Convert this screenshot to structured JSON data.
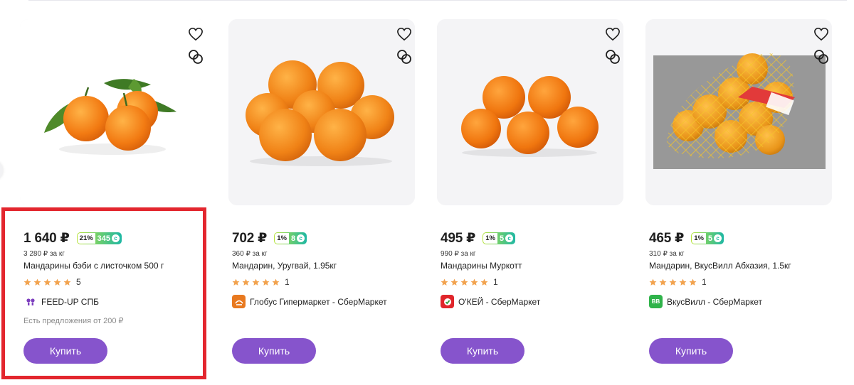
{
  "currency": "₽",
  "products": [
    {
      "price": "1 640 ₽",
      "bonus_percent": "21%",
      "bonus_points": "345",
      "unit_price": "3 280 ₽ за кг",
      "title": "Мандарины бэби с листочком 500 г",
      "rating_stars": 5,
      "rating_count": "5",
      "seller": "FEED-UP СПБ",
      "seller_logo_icon": "feedup-logo-icon",
      "seller_logo_color": "#ffffff",
      "offers": "Есть предложения от 200 ₽",
      "buy_label": "Купить",
      "highlighted": true
    },
    {
      "price": "702 ₽",
      "bonus_percent": "1%",
      "bonus_points": "8",
      "unit_price": "360 ₽ за кг",
      "title": "Мандарин, Уругвай, 1.95кг",
      "rating_stars": 5,
      "rating_count": "1",
      "seller": "Глобус Гипермаркет - СберМаркет",
      "seller_logo_icon": "globus-logo-icon",
      "seller_logo_color": "#e8791f",
      "buy_label": "Купить"
    },
    {
      "price": "495 ₽",
      "bonus_percent": "1%",
      "bonus_points": "5",
      "unit_price": "990 ₽ за кг",
      "title": "Мандарины Муркотт",
      "rating_stars": 5,
      "rating_count": "1",
      "seller": "О'КЕЙ - СберМаркет",
      "seller_logo_icon": "okey-logo-icon",
      "seller_logo_color": "#e0262b",
      "buy_label": "Купить"
    },
    {
      "price": "465 ₽",
      "bonus_percent": "1%",
      "bonus_points": "5",
      "unit_price": "310 ₽ за кг",
      "title": "Мандарин, ВкусВилл Абхазия, 1.5кг",
      "rating_stars": 5,
      "rating_count": "1",
      "seller": "ВкусВилл - СберМаркет",
      "seller_logo_icon": "vkusvill-logo-icon",
      "seller_logo_text": "BB",
      "seller_logo_color": "#2fb34a",
      "buy_label": "Купить"
    }
  ],
  "colors": {
    "accent": "#8654cc",
    "star": "#f2a34f",
    "highlight": "#e3262e",
    "bonus_gradient": [
      "#b8e33b",
      "#1fb8a4"
    ]
  }
}
